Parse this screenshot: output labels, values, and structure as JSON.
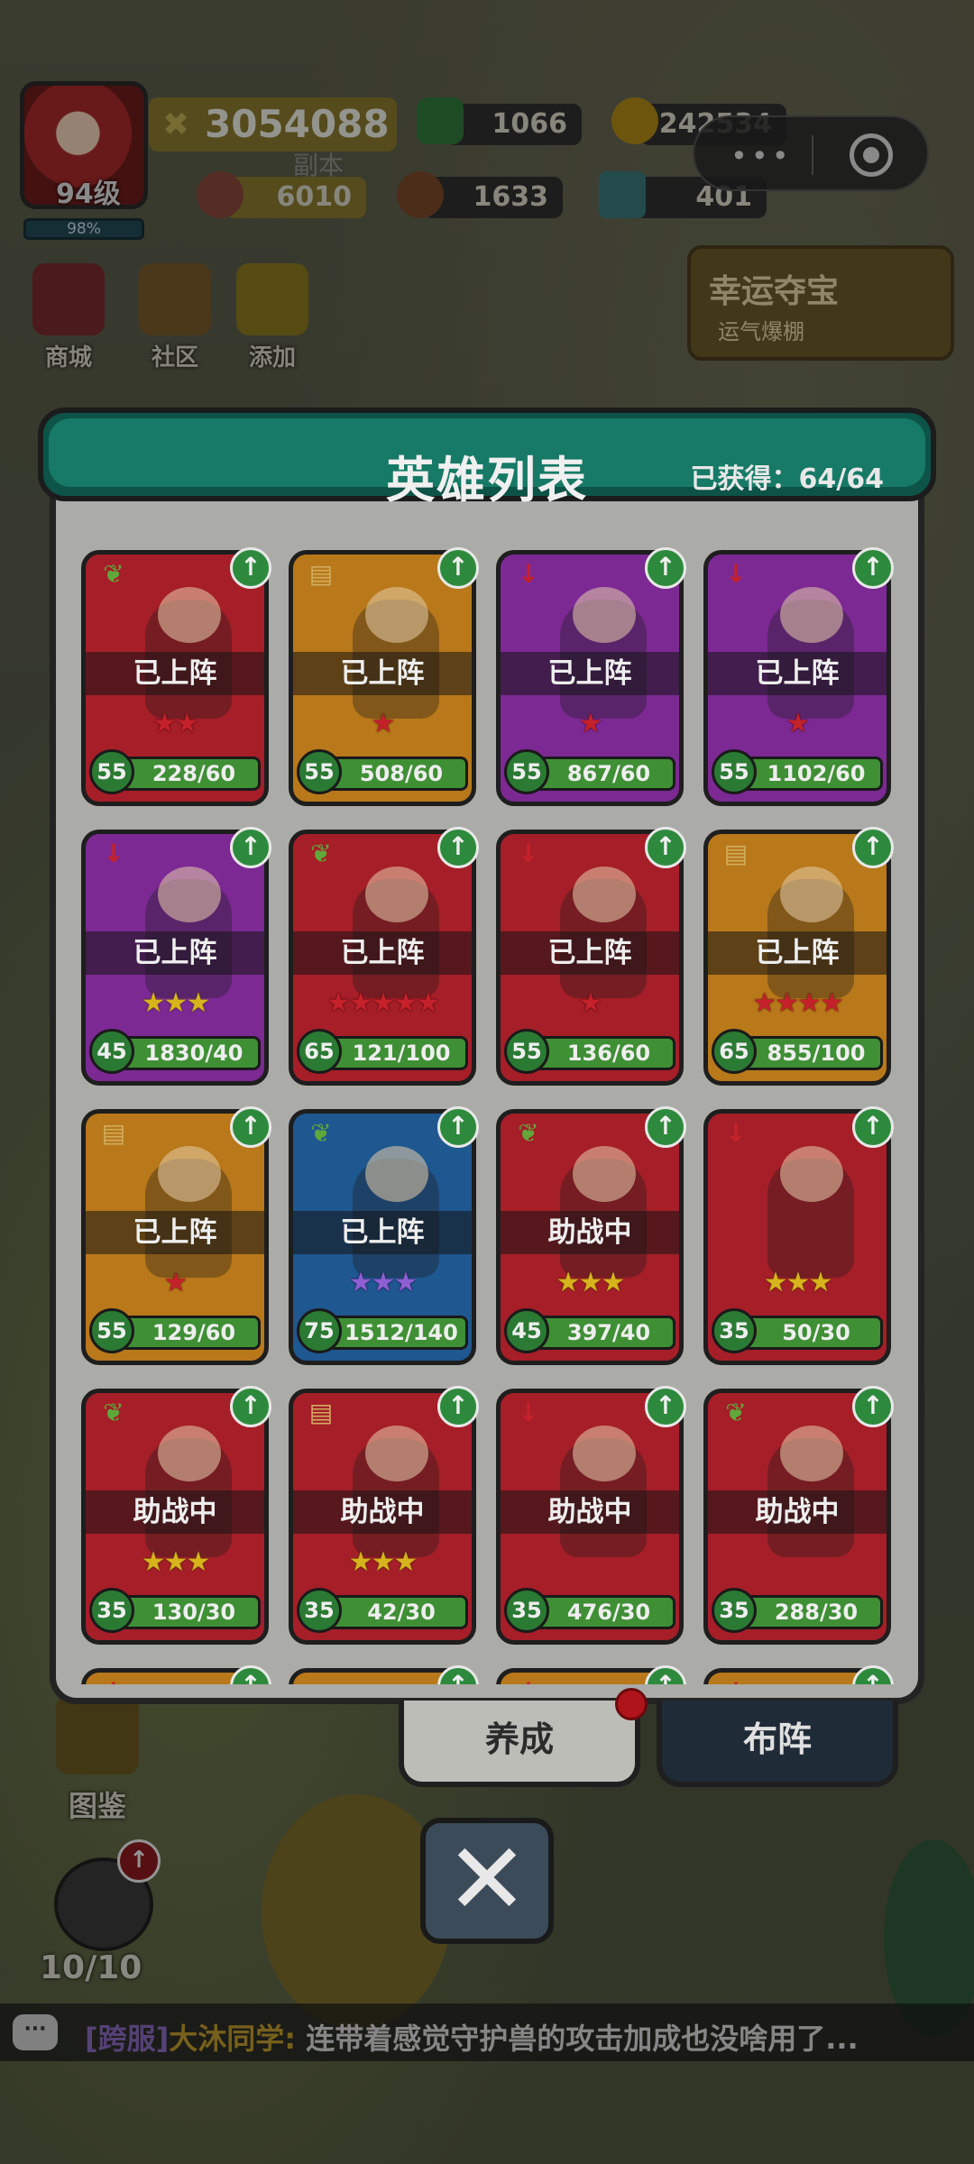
{
  "hud": {
    "level": "94级",
    "exp": "98%",
    "power": "3054088",
    "resources": {
      "gem": "1066",
      "gold": "242534",
      "meat": "6010",
      "wood": "1633",
      "crystal": "401"
    },
    "ghost_text": "副本",
    "buttons": {
      "shop": "商城",
      "community": "社区",
      "add": "添加"
    },
    "lucky": {
      "title": "幸运夺宝",
      "subtitle": "运气爆棚"
    },
    "mini_program_dots": "•••"
  },
  "modal": {
    "title": "英雄列表",
    "obtained_label": "已获得：",
    "obtained": "64/64"
  },
  "heroes": [
    {
      "status": "已上阵",
      "level": "55",
      "shards": "228/60",
      "progress": 1.0,
      "rarity": "red",
      "type": "leaf",
      "stars": 2,
      "star_color": "red"
    },
    {
      "status": "已上阵",
      "level": "55",
      "shards": "508/60",
      "progress": 1.0,
      "rarity": "gold",
      "type": "book",
      "stars": 1,
      "star_color": "red"
    },
    {
      "status": "已上阵",
      "level": "55",
      "shards": "867/60",
      "progress": 1.0,
      "rarity": "purple",
      "type": "sword",
      "stars": 1,
      "star_color": "red"
    },
    {
      "status": "已上阵",
      "level": "55",
      "shards": "1102/60",
      "progress": 1.0,
      "rarity": "purple",
      "type": "sword",
      "stars": 1,
      "star_color": "red"
    },
    {
      "status": "已上阵",
      "level": "45",
      "shards": "1830/40",
      "progress": 1.0,
      "rarity": "purple",
      "type": "sword",
      "stars": 3,
      "star_color": "gold"
    },
    {
      "status": "已上阵",
      "level": "65",
      "shards": "121/100",
      "progress": 1.0,
      "rarity": "red",
      "type": "leaf",
      "stars": 5,
      "star_color": "red"
    },
    {
      "status": "已上阵",
      "level": "55",
      "shards": "136/60",
      "progress": 1.0,
      "rarity": "red",
      "type": "sword",
      "stars": 1,
      "star_color": "red"
    },
    {
      "status": "已上阵",
      "level": "65",
      "shards": "855/100",
      "progress": 1.0,
      "rarity": "gold",
      "type": "book",
      "stars": 4,
      "star_color": "red"
    },
    {
      "status": "已上阵",
      "level": "55",
      "shards": "129/60",
      "progress": 1.0,
      "rarity": "gold",
      "type": "book",
      "stars": 1,
      "star_color": "red"
    },
    {
      "status": "已上阵",
      "level": "75",
      "shards": "1512/140",
      "progress": 1.0,
      "rarity": "blue",
      "type": "leaf",
      "stars": 3,
      "star_color": "purple"
    },
    {
      "status": "助战中",
      "level": "45",
      "shards": "397/40",
      "progress": 1.0,
      "rarity": "red",
      "type": "leaf",
      "stars": 3,
      "star_color": "gold"
    },
    {
      "status": "",
      "level": "35",
      "shards": "50/30",
      "progress": 1.0,
      "rarity": "red",
      "type": "sword",
      "stars": 3,
      "star_color": "gold"
    },
    {
      "status": "助战中",
      "level": "35",
      "shards": "130/30",
      "progress": 1.0,
      "rarity": "red",
      "type": "leaf",
      "stars": 3,
      "star_color": "gold"
    },
    {
      "status": "助战中",
      "level": "35",
      "shards": "42/30",
      "progress": 1.0,
      "rarity": "red",
      "type": "book",
      "stars": 3,
      "star_color": "gold"
    },
    {
      "status": "助战中",
      "level": "35",
      "shards": "476/30",
      "progress": 1.0,
      "rarity": "red",
      "type": "sword",
      "stars": 0,
      "star_color": "gold"
    },
    {
      "status": "助战中",
      "level": "35",
      "shards": "288/30",
      "progress": 1.0,
      "rarity": "red",
      "type": "leaf",
      "stars": 0,
      "star_color": "gold"
    },
    {
      "status": "",
      "level": "",
      "shards": "",
      "progress": 1.0,
      "rarity": "gold",
      "type": "sword",
      "stars": 0,
      "star_color": "gold"
    },
    {
      "status": "",
      "level": "",
      "shards": "",
      "progress": 1.0,
      "rarity": "gold",
      "type": "book",
      "stars": 0,
      "star_color": "gold"
    },
    {
      "status": "",
      "level": "",
      "shards": "",
      "progress": 1.0,
      "rarity": "gold",
      "type": "sword",
      "stars": 0,
      "star_color": "gold"
    },
    {
      "status": "",
      "level": "",
      "shards": "",
      "progress": 1.0,
      "rarity": "gold",
      "type": "sword",
      "stars": 0,
      "star_color": "gold"
    }
  ],
  "tabs": {
    "train": "养成",
    "formation": "布阵"
  },
  "close_label": "✕",
  "album_label": "图鉴",
  "helmet_count": "10/10",
  "chat": {
    "tag": "[跨服]",
    "user": "大沐同学:",
    "message": " 连带着感觉守护兽的攻击加成也没啥用了..."
  },
  "icons": {
    "up": "arrow-up-icon",
    "leaf": "leaf-icon",
    "book": "book-icon",
    "sword": "sword-icon",
    "close": "close-icon",
    "chat": "chat-icon"
  },
  "colors": {
    "red_card": "#a61e28",
    "gold_card": "#b9781a",
    "purple_card": "#7c2994",
    "blue_card": "#1f5790",
    "header_teal": "#167a66"
  }
}
